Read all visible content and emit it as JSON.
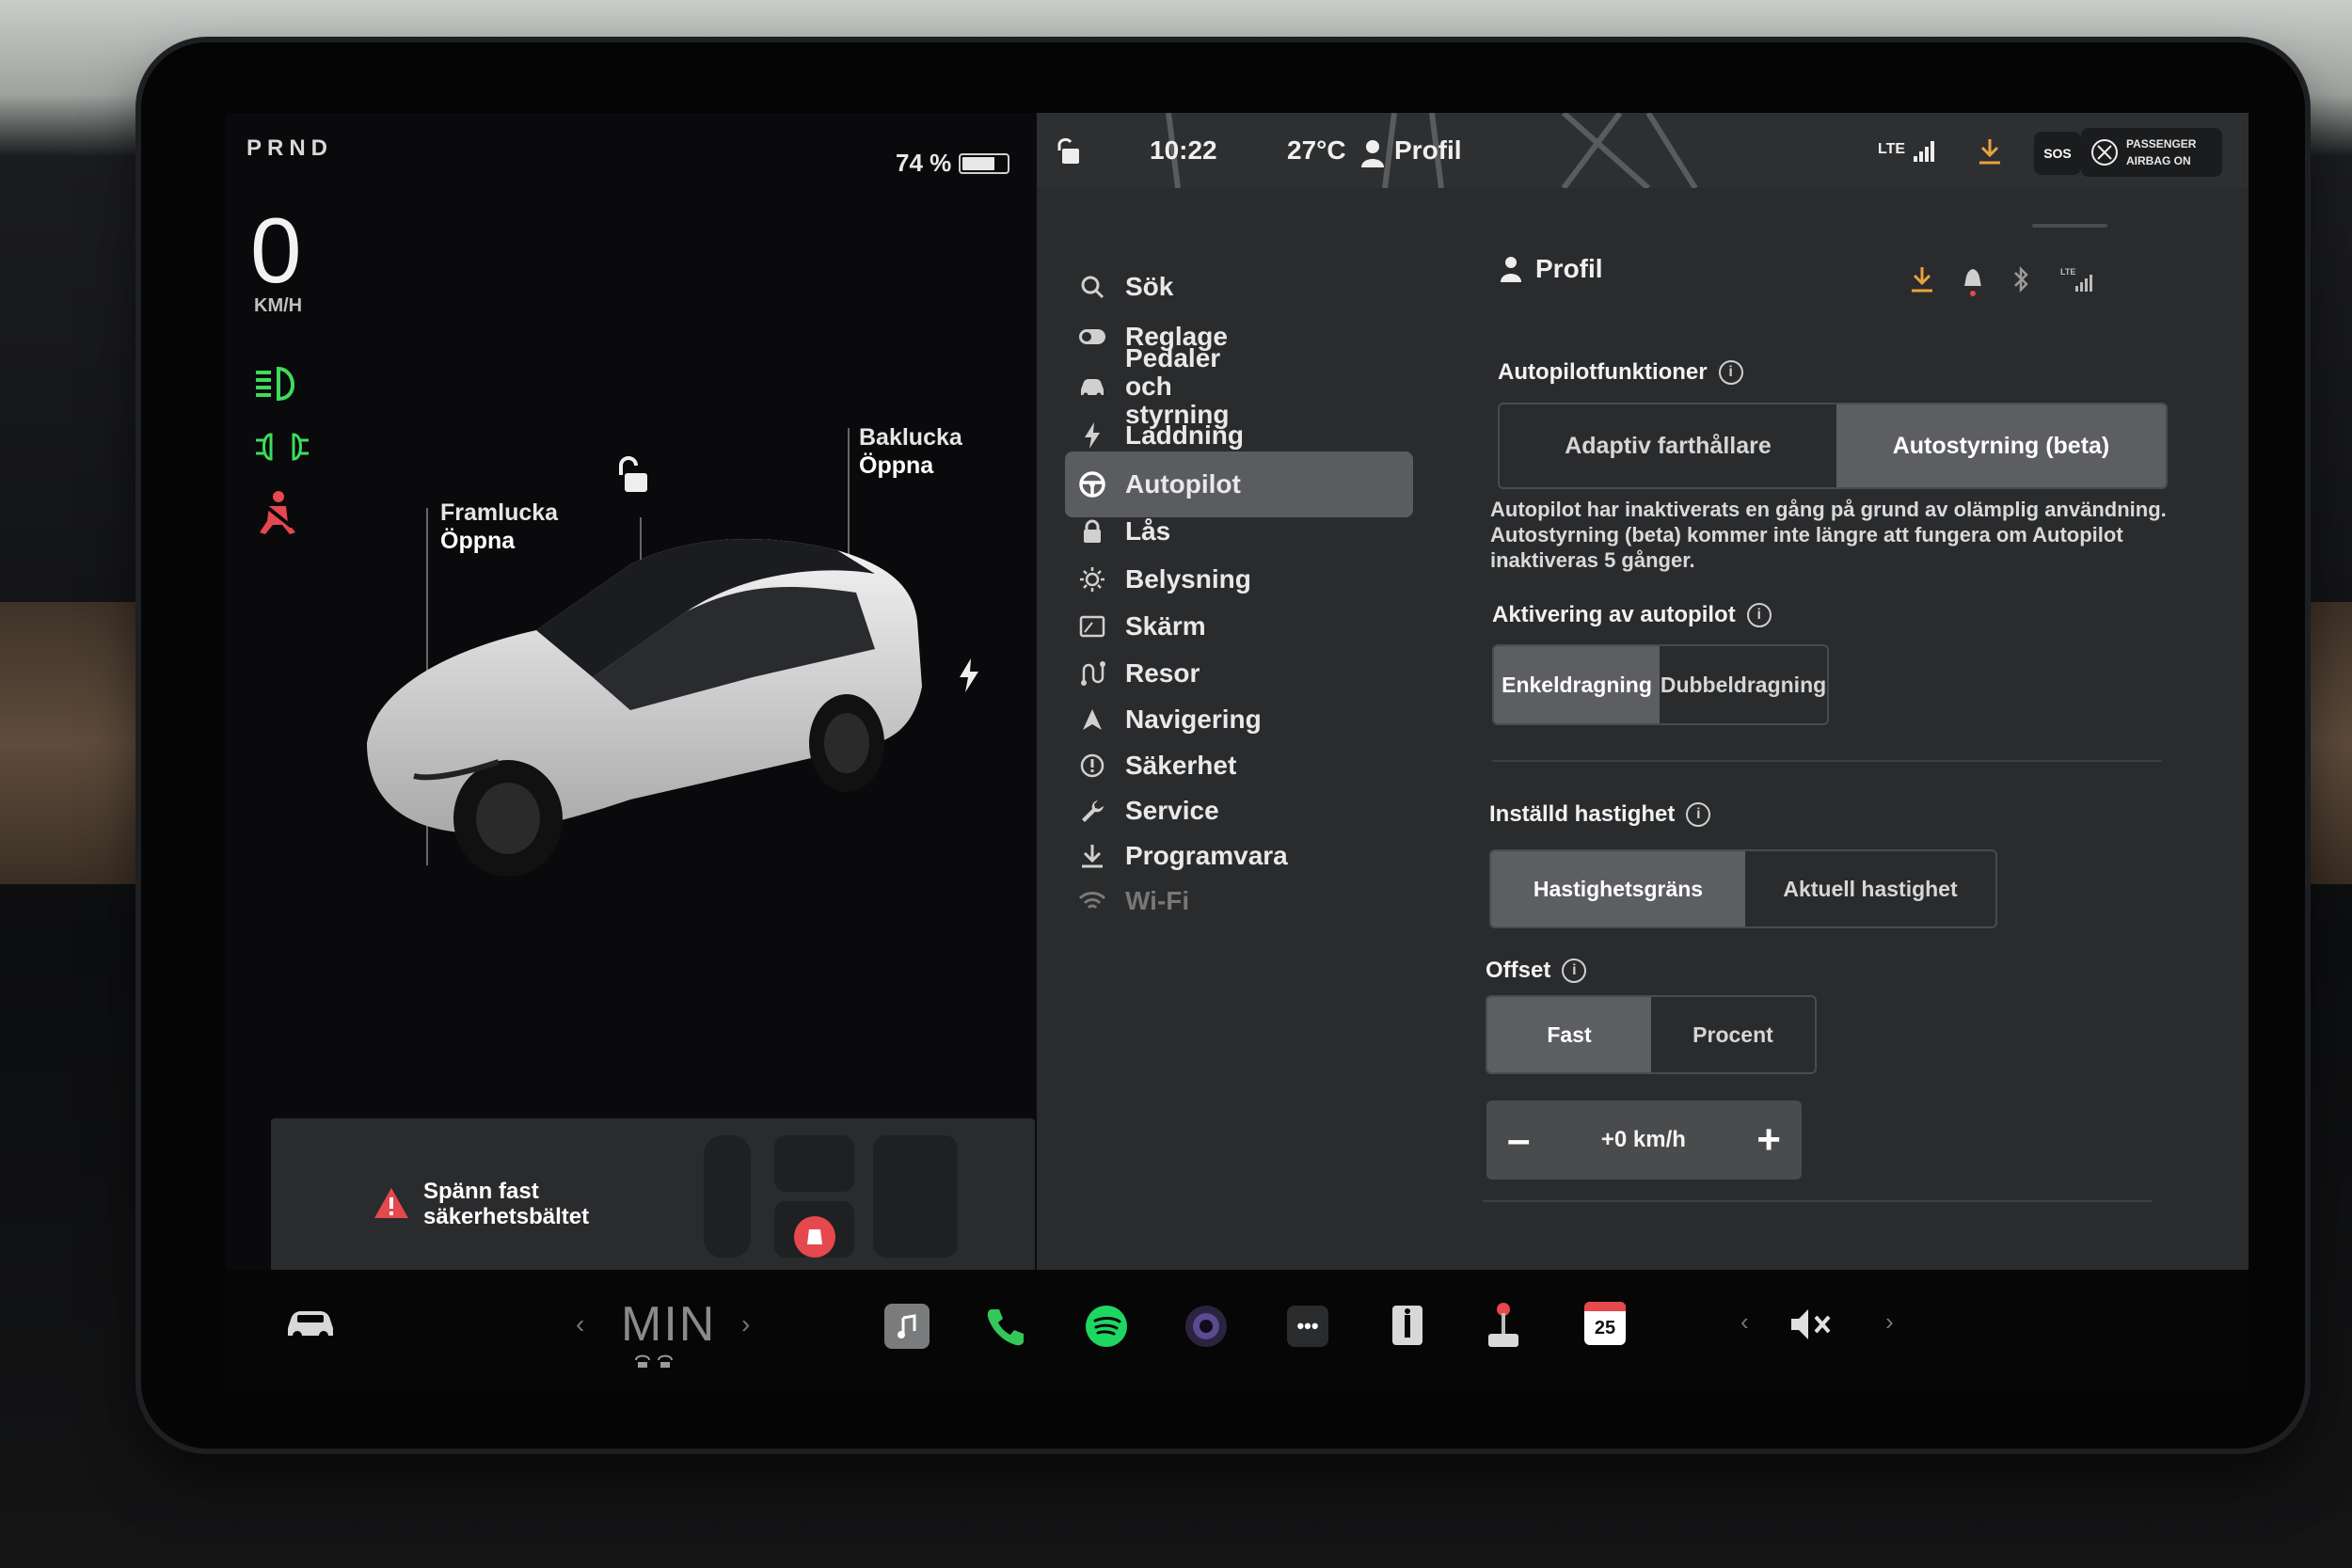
{
  "drive": {
    "gears": "PRND",
    "speed": "0",
    "speed_unit": "KM/H",
    "battery": "74 %",
    "battery_level": 0.74
  },
  "car_labels": {
    "frunk_title": "Framlucka",
    "frunk_state": "Öppna",
    "trunk_title": "Baklucka",
    "trunk_state": "Öppna"
  },
  "warning": {
    "text": "Spänn fast säkerhetsbältet"
  },
  "status_bar": {
    "time": "10:22",
    "temperature": "27°C",
    "profile": "Profil",
    "network": "LTE",
    "sos": "SOS",
    "airbag_line1": "PASSENGER",
    "airbag_line2": "AIRBAG ON"
  },
  "nav": {
    "items": [
      {
        "label": "Sök",
        "icon": "search-icon"
      },
      {
        "label": "Reglage",
        "icon": "toggle-icon"
      },
      {
        "label": "Pedaler och styrning",
        "icon": "car-icon"
      },
      {
        "label": "Laddning",
        "icon": "bolt-icon"
      },
      {
        "label": "Autopilot",
        "icon": "steering-wheel-icon",
        "active": true
      },
      {
        "label": "Lås",
        "icon": "lock-icon"
      },
      {
        "label": "Belysning",
        "icon": "sun-icon"
      },
      {
        "label": "Skärm",
        "icon": "display-icon"
      },
      {
        "label": "Resor",
        "icon": "trips-icon"
      },
      {
        "label": "Navigering",
        "icon": "navigation-icon"
      },
      {
        "label": "Säkerhet",
        "icon": "safety-icon"
      },
      {
        "label": "Service",
        "icon": "wrench-icon"
      },
      {
        "label": "Programvara",
        "icon": "download-icon"
      },
      {
        "label": "Wi-Fi",
        "icon": "wifi-icon"
      }
    ]
  },
  "panel": {
    "header": "Profil",
    "autopilot_features": {
      "title": "Autopilotfunktioner",
      "options": [
        "Adaptiv farthållare",
        "Autostyrning (beta)"
      ],
      "selected": 1,
      "description": "Autopilot har inaktiverats en gång på grund av olämplig användning. Autostyrning (beta) kommer inte längre att fungera om Autopilot inaktiveras 5 gånger."
    },
    "activation": {
      "title": "Aktivering av autopilot",
      "options": [
        "Enkeldragning",
        "Dubbeldragning"
      ],
      "selected": 0
    },
    "set_speed": {
      "title": "Inställd hastighet",
      "options": [
        "Hastighetsgräns",
        "Aktuell hastighet"
      ],
      "selected": 0
    },
    "offset": {
      "title": "Offset",
      "options": [
        "Fast",
        "Procent"
      ],
      "selected": 0,
      "value": "+0 km/h",
      "minus": "–",
      "plus": "+"
    }
  },
  "taskbar": {
    "climate_label": "MIN",
    "calendar_day": "25"
  },
  "colors": {
    "headlight_green": "#3ddc5a",
    "seatbelt_red": "#e5484d",
    "download_orange": "#e8a33a",
    "panel_bg": "#2a2b2d",
    "selected_segment": "#5c5e61"
  }
}
